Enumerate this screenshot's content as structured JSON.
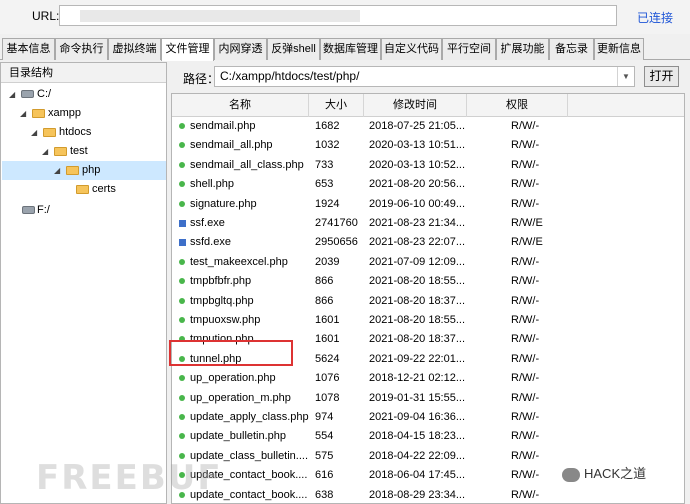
{
  "url_bar": {
    "label": "URL:",
    "status": "已连接"
  },
  "tabs": [
    {
      "label": "基本信息"
    },
    {
      "label": "命令执行"
    },
    {
      "label": "虚拟终端"
    },
    {
      "label": "文件管理",
      "active": true
    },
    {
      "label": "内网穿透"
    },
    {
      "label": "反弹shell"
    },
    {
      "label": "数据库管理"
    },
    {
      "label": "自定义代码"
    },
    {
      "label": "平行空间"
    },
    {
      "label": "扩展功能"
    },
    {
      "label": "备忘录"
    },
    {
      "label": "更新信息"
    }
  ],
  "tree": {
    "header": "目录结构",
    "nodes": [
      {
        "label": "C:/",
        "icon": "drive-icon"
      },
      {
        "label": "xampp",
        "icon": "folder-icon"
      },
      {
        "label": "htdocs",
        "icon": "folder-icon"
      },
      {
        "label": "test",
        "icon": "folder-icon"
      },
      {
        "label": "php",
        "icon": "folder-icon",
        "selected": true
      },
      {
        "label": "certs",
        "icon": "folder-icon"
      },
      {
        "label": "F:/",
        "icon": "drive-icon"
      }
    ]
  },
  "path": {
    "label": "路径：",
    "value": "C:/xampp/htdocs/test/php/",
    "open_button": "打开"
  },
  "table": {
    "columns": [
      "名称",
      "大小",
      "修改时间",
      "权限"
    ],
    "rows": [
      {
        "name": "sendmail.php",
        "size": "1682",
        "time": "2018-07-25 21:05...",
        "perm": "R/W/-",
        "type": "php"
      },
      {
        "name": "sendmail_all.php",
        "size": "1032",
        "time": "2020-03-13 10:51...",
        "perm": "R/W/-",
        "type": "php"
      },
      {
        "name": "sendmail_all_class.php",
        "size": "733",
        "time": "2020-03-13 10:52...",
        "perm": "R/W/-",
        "type": "php"
      },
      {
        "name": "shell.php",
        "size": "653",
        "time": "2021-08-20 20:56...",
        "perm": "R/W/-",
        "type": "php"
      },
      {
        "name": "signature.php",
        "size": "1924",
        "time": "2019-06-10 00:49...",
        "perm": "R/W/-",
        "type": "php"
      },
      {
        "name": "ssf.exe",
        "size": "2741760",
        "time": "2021-08-23 21:34...",
        "perm": "R/W/E",
        "type": "exe"
      },
      {
        "name": "ssfd.exe",
        "size": "2950656",
        "time": "2021-08-23 22:07...",
        "perm": "R/W/E",
        "type": "exe"
      },
      {
        "name": "test_makeexcel.php",
        "size": "2039",
        "time": "2021-07-09 12:09...",
        "perm": "R/W/-",
        "type": "php"
      },
      {
        "name": "tmpbfbfr.php",
        "size": "866",
        "time": "2021-08-20 18:55...",
        "perm": "R/W/-",
        "type": "php"
      },
      {
        "name": "tmpbgltq.php",
        "size": "866",
        "time": "2021-08-20 18:37...",
        "perm": "R/W/-",
        "type": "php"
      },
      {
        "name": "tmpuoxsw.php",
        "size": "1601",
        "time": "2021-08-20 18:55...",
        "perm": "R/W/-",
        "type": "php"
      },
      {
        "name": "tmpution.php",
        "size": "1601",
        "time": "2021-08-20 18:37...",
        "perm": "R/W/-",
        "type": "php"
      },
      {
        "name": "tunnel.php",
        "size": "5624",
        "time": "2021-09-22 22:01...",
        "perm": "R/W/-",
        "type": "php"
      },
      {
        "name": "up_operation.php",
        "size": "1076",
        "time": "2018-12-21 02:12...",
        "perm": "R/W/-",
        "type": "php"
      },
      {
        "name": "up_operation_m.php",
        "size": "1078",
        "time": "2019-01-31 15:55...",
        "perm": "R/W/-",
        "type": "php"
      },
      {
        "name": "update_apply_class.php",
        "size": "974",
        "time": "2021-09-04 16:36...",
        "perm": "R/W/-",
        "type": "php"
      },
      {
        "name": "update_bulletin.php",
        "size": "554",
        "time": "2018-04-15 18:23...",
        "perm": "R/W/-",
        "type": "php"
      },
      {
        "name": "update_class_bulletin....",
        "size": "575",
        "time": "2018-04-22 22:09...",
        "perm": "R/W/-",
        "type": "php"
      },
      {
        "name": "update_contact_book....",
        "size": "616",
        "time": "2018-06-04 17:45...",
        "perm": "R/W/-",
        "type": "php"
      },
      {
        "name": "update_contact_book....",
        "size": "638",
        "time": "2018-08-29 23:34...",
        "perm": "R/W/-",
        "type": "php"
      }
    ]
  },
  "watermarks": {
    "left": "FREEBUF",
    "right": "HACK之道"
  },
  "colors": {
    "highlight_border": "#d33333",
    "selected_bg": "#cde8ff",
    "status_link": "#1f56d6"
  }
}
